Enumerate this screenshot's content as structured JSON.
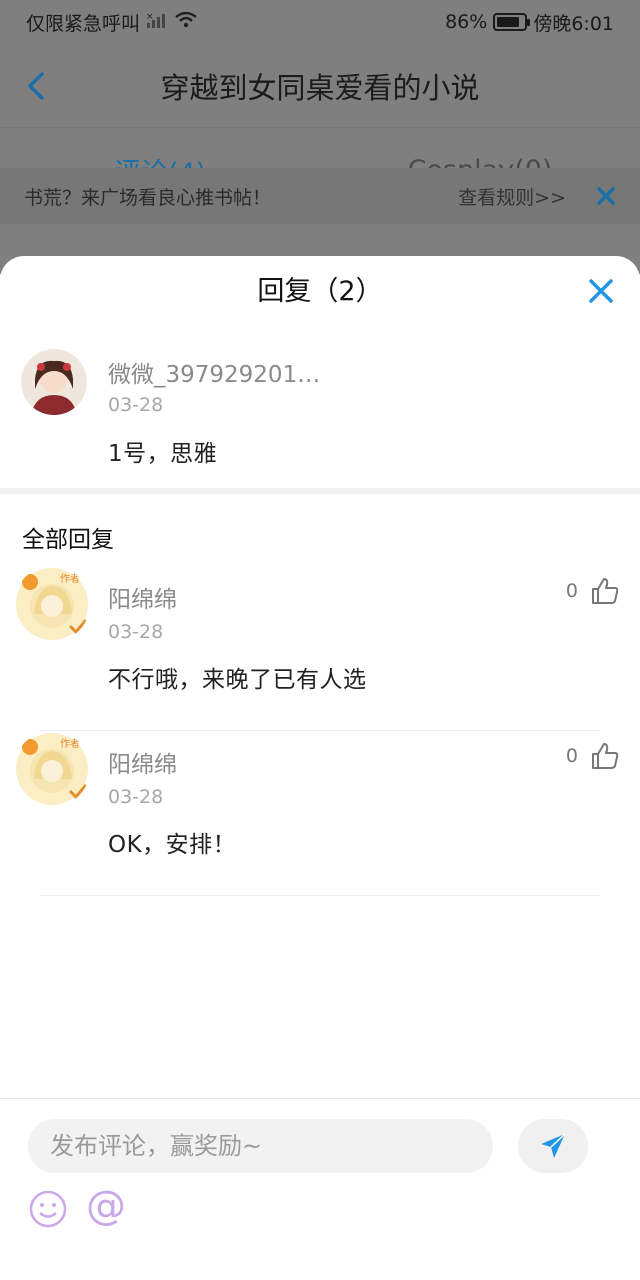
{
  "status": {
    "carrier": "仅限紧急呼叫",
    "battery_text": "86%",
    "battery_level": 0.86,
    "time": "傍晚6:01"
  },
  "page": {
    "title": "穿越到女同桌爱看的小说",
    "tabs": [
      {
        "label": "评论(4)",
        "active": true
      },
      {
        "label": "Cosplay(0)",
        "active": false
      }
    ],
    "banner": {
      "text": "书荒？来广场看良心推书帖！",
      "link": "查看规则>>"
    }
  },
  "sheet": {
    "title": "回复（2）",
    "original": {
      "name": "微微_397929201…",
      "date": "03-28",
      "text": "1号，思雅"
    },
    "section_title": "全部回复",
    "replies": [
      {
        "name": "阳绵绵",
        "date": "03-28",
        "text": "不行哦，来晚了已有人选",
        "likes": "0",
        "badge": "作者"
      },
      {
        "name": "阳绵绵",
        "date": "03-28",
        "text": "OK，安排！",
        "likes": "0",
        "badge": "作者"
      }
    ],
    "composer": {
      "placeholder": "发布评论，赢奖励~"
    }
  },
  "colors": {
    "accent": "#2196e6",
    "tab_active": "#1a6fa8",
    "overlay": "#7f7f7f"
  }
}
